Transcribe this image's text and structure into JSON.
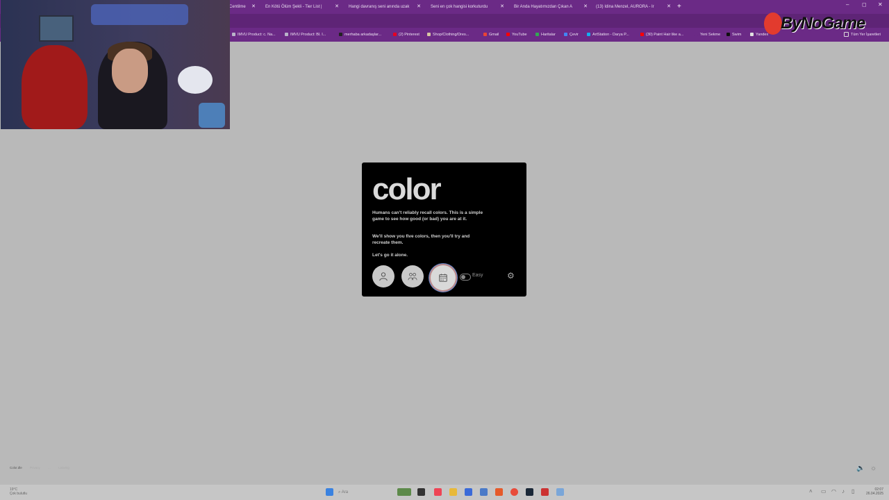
{
  "browser": {
    "tabs": [
      {
        "label": "Centilme"
      },
      {
        "label": "En Kötü Ölüm Şekli - Tier List |"
      },
      {
        "label": "Hangi davranış seni anında uzak"
      },
      {
        "label": "Seni en çok hangisi korkuturdu"
      },
      {
        "label": "Bir Anda Hayatımızdan Çıkan A"
      },
      {
        "label": "(13) Idina Menzel, AURORA - Ir"
      }
    ],
    "new_tab": "+",
    "window_controls": {
      "minimize": "–",
      "restore": "◻",
      "close": "✕"
    },
    "bookmarks": [
      {
        "label": "IMVU Product: c. Na...",
        "color": "#b9b4c9"
      },
      {
        "label": "IMVU Product: Bl. I...",
        "color": "#b9b4c9"
      },
      {
        "label": "merhaba arkadaşlar...",
        "color": "#222222"
      },
      {
        "label": "(2) Pinterest",
        "color": "#e60023"
      },
      {
        "label": "Shop/Clothing/Dres...",
        "color": "#d7c7a3"
      },
      {
        "label": "Gmail",
        "color": "#ea4335"
      },
      {
        "label": "YouTube",
        "color": "#ff0000"
      },
      {
        "label": "Haritalar",
        "color": "#34a853"
      },
      {
        "label": "Çevir",
        "color": "#4285f4"
      },
      {
        "label": "ArtStation - Darya P...",
        "color": "#13aff0"
      },
      {
        "label": "(30) Paint Hair like a...",
        "color": "#ff0000"
      },
      {
        "label": "Yeni Sekme",
        "color": "#6b2a86"
      },
      {
        "label": "Swim",
        "color": "#111111"
      },
      {
        "label": "Yandex",
        "color": "#e0e0e0"
      }
    ],
    "all_bookmarks": "Tüm Yer İşaretleri"
  },
  "overlay": {
    "logo_text": "ByNoGame"
  },
  "game": {
    "title": "color",
    "intro": "Humans can't reliably recall colors. This is a simple game to see how good (or bad) you are at it.",
    "instructions": "We'll show you five colors, then you'll try and recreate them.",
    "mode_prompt": "Let's go it alone.",
    "difficulty_label": "Easy",
    "difficulty_toggle_on": false
  },
  "footer": {
    "links": [
      "Color.dle",
      "Privacy",
      "...",
      "Leaving"
    ]
  },
  "taskbar": {
    "weather_temp": "19°C",
    "weather_desc": "Çok bulutlu",
    "search_placeholder": "Ara",
    "time": "02:07",
    "date": "26.04.2025"
  }
}
